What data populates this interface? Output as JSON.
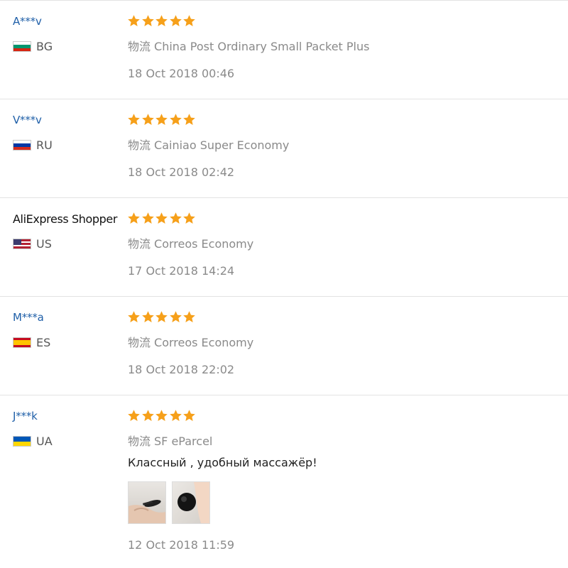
{
  "reviews": [
    {
      "user": "A***v",
      "country": "BG",
      "flag_colors": [
        "#ffffff",
        "#00966e",
        "#d62612"
      ],
      "stars": 5,
      "logistics_label": "物流",
      "logistics": "China Post Ordinary Small Packet Plus",
      "date": "18 Oct 2018 00:46"
    },
    {
      "user": "V***v",
      "country": "RU",
      "flag_colors": [
        "#ffffff",
        "#0039a6",
        "#d52b1e"
      ],
      "stars": 5,
      "logistics_label": "物流",
      "logistics": "Cainiao Super Economy",
      "date": "18 Oct 2018 02:42"
    },
    {
      "user": "AliExpress Shopper",
      "country": "US",
      "flag_colors": [
        "#b22234",
        "#ffffff",
        "#3c3b6e"
      ],
      "stars": 5,
      "logistics_label": "物流",
      "logistics": "Correos Economy",
      "date": "17 Oct 2018 14:24"
    },
    {
      "user": "M***a",
      "country": "ES",
      "flag_colors": [
        "#c60b1e",
        "#ffc400",
        "#c60b1e"
      ],
      "stars": 5,
      "logistics_label": "物流",
      "logistics": "Correos Economy",
      "date": "18 Oct 2018 22:02"
    },
    {
      "user": "J***k",
      "country": "UA",
      "flag_colors": [
        "#0057b7",
        "#ffd700"
      ],
      "stars": 5,
      "logistics_label": "物流",
      "logistics": "SF eParcel",
      "comment": "Классный , удобный массажёр!",
      "photos": [
        "review-photo-1",
        "review-photo-2"
      ],
      "date": "12 Oct 2018 11:59"
    }
  ],
  "colors": {
    "star": "#f6a01a",
    "username_link": "#1f5fa8",
    "meta_text": "#8a8a8a",
    "divider": "#e3e3e3"
  }
}
